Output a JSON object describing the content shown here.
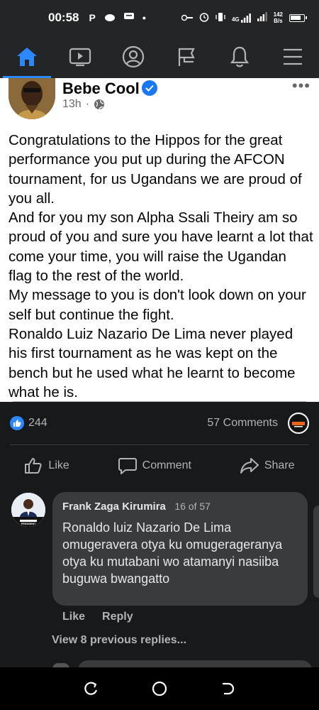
{
  "status_bar": {
    "time": "00:58",
    "left_icons": [
      "P",
      "•"
    ],
    "network_label": "4G",
    "net_speed_value": "142",
    "net_speed_unit": "B/s",
    "battery_level": 0.85
  },
  "nav": {
    "items": [
      {
        "name": "home",
        "icon": "home-icon",
        "active": true
      },
      {
        "name": "watch",
        "icon": "video-icon",
        "active": false
      },
      {
        "name": "profile",
        "icon": "profile-icon",
        "active": false
      },
      {
        "name": "pages",
        "icon": "flag-icon",
        "active": false
      },
      {
        "name": "notifications",
        "icon": "bell-icon",
        "active": false
      },
      {
        "name": "menu",
        "icon": "hamburger-icon",
        "active": false
      }
    ]
  },
  "post": {
    "author": "Bebe Cool",
    "verified": true,
    "time": "13h",
    "audience_icon": "globe-icon",
    "paragraphs": [
      "Congratulations to the Hippos for the great performance you put up during the AFCON tournament, for us Ugandans we are proud of you all.",
      "And for you my son Alpha Ssali Theiry am so proud of you and sure you have learnt a lot that come your time, you will raise the Ugandan flag to the rest of the world.",
      "My message to you is don't look down on your self but continue the fight.",
      "Ronaldo Luiz Nazario De Lima never played his first tournament as he was kept on the bench but he used what he learnt to become what he is."
    ]
  },
  "reactions": {
    "likes": "244",
    "comments": "57 Comments"
  },
  "actions": {
    "like": "Like",
    "comment": "Comment",
    "share": "Share"
  },
  "comment": {
    "author": "Frank Zaga Kirumira",
    "index": "16 of 57",
    "text": "Ronaldo luiz Nazario De Lima omugeravera otya ku omugerageranya otya ku mutabani wo atamanyi nasiiba buguwa bwangatto",
    "avatar_caption": "PRESIDENT",
    "like_label": "Like",
    "reply_label": "Reply",
    "view_replies": "View 8 previous replies..."
  },
  "colors": {
    "accent": "#2d88ff",
    "dark_bg": "#18191a",
    "bubble": "#3a3b3c",
    "muted": "#b0b3b8"
  }
}
